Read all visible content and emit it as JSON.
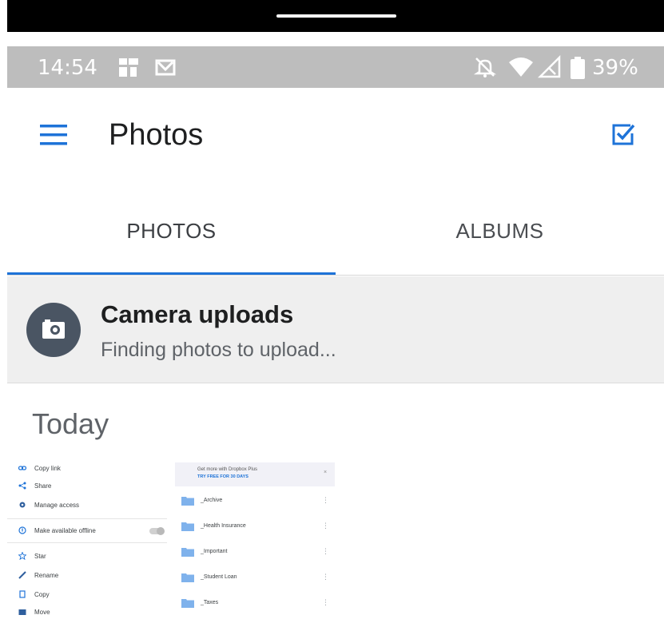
{
  "status_bar": {
    "time": "14:54",
    "battery": "39%",
    "icons": [
      "news-icon",
      "mail-icon",
      "bell-off-icon",
      "wifi-icon",
      "signal-icon",
      "battery-icon"
    ]
  },
  "app_bar": {
    "title": "Photos",
    "menu_icon": "menu-icon",
    "select_icon": "checkbox-icon"
  },
  "tabs": [
    {
      "label": "PHOTOS",
      "selected": true
    },
    {
      "label": "ALBUMS",
      "selected": false
    }
  ],
  "camera_uploads": {
    "title": "Camera uploads",
    "status": "Finding photos to upload..."
  },
  "section": {
    "title": "Today"
  },
  "thumbnail": {
    "menu": [
      {
        "label": "Copy link",
        "icon": "link-icon"
      },
      {
        "label": "Share",
        "icon": "share-icon"
      },
      {
        "label": "Manage access",
        "icon": "gear-icon"
      },
      {
        "label": "Make available offline",
        "icon": "offline-icon"
      },
      {
        "label": "Star",
        "icon": "star-icon"
      },
      {
        "label": "Rename",
        "icon": "pencil-icon"
      },
      {
        "label": "Copy",
        "icon": "copy-icon"
      },
      {
        "label": "Move",
        "icon": "folder-move-icon"
      }
    ],
    "promo": {
      "line1": "Get more with Dropbox Plus",
      "line2": "TRY FREE FOR 30 DAYS"
    },
    "folders": [
      "_Archive",
      "_Health Insurance",
      "_Important",
      "_Student Loan",
      "_Taxes"
    ]
  },
  "colors": {
    "accent": "#1e73d8",
    "status_bar": "#bdbdbd",
    "upload_banner": "#efefef",
    "camera_circle": "#4a5563"
  }
}
